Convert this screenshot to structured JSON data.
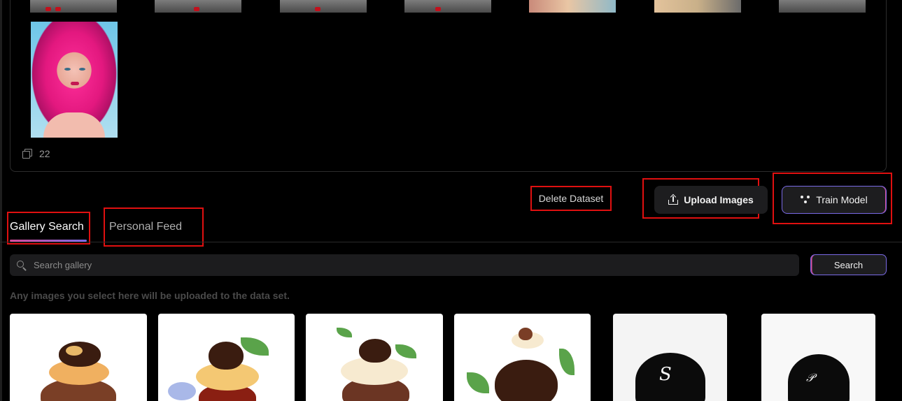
{
  "dataset": {
    "image_count": "22"
  },
  "actions": {
    "delete_label": "Delete Dataset",
    "upload_label": "Upload Images",
    "train_label": "Train Model"
  },
  "tabs": [
    {
      "label": "Gallery Search",
      "active": true
    },
    {
      "label": "Personal Feed",
      "active": false
    }
  ],
  "search": {
    "placeholder": "Search gallery",
    "value": "",
    "button_label": "Search"
  },
  "hint": "Any images you select here will be uploaded to the data set.",
  "icons": {
    "count": "copy-icon",
    "upload": "upload-icon",
    "train": "model-icon",
    "search": "search-icon"
  },
  "colors": {
    "background": "#000000",
    "accent_pink": "#d84c9a",
    "accent_purple": "#7a6ae6",
    "highlight_box": "#e01010",
    "button_bg": "#1d1d1f"
  }
}
